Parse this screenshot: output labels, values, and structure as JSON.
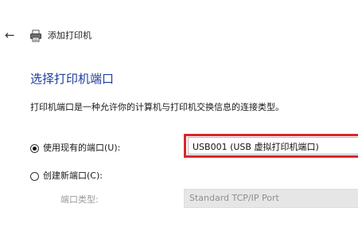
{
  "header": {
    "back_icon": "back-arrow-icon",
    "printer_icon": "printer-icon",
    "title": "添加打印机"
  },
  "page": {
    "title": "选择打印机端口",
    "description": "打印机端口是一种允许你的计算机与打印机交换信息的连接类型。"
  },
  "options": {
    "use_existing": {
      "label": "使用现有的端口(U):",
      "checked": true,
      "port_value": "USB001 (USB 虚拟打印机端口)"
    },
    "create_new": {
      "label": "创建新端口(C):",
      "checked": false,
      "port_type_label": "端口类型:",
      "port_type_value": "Standard TCP/IP Port"
    }
  },
  "colors": {
    "title": "#1f3f9a",
    "highlight": "#d9262c",
    "disabled_text": "#9a9a9a"
  }
}
